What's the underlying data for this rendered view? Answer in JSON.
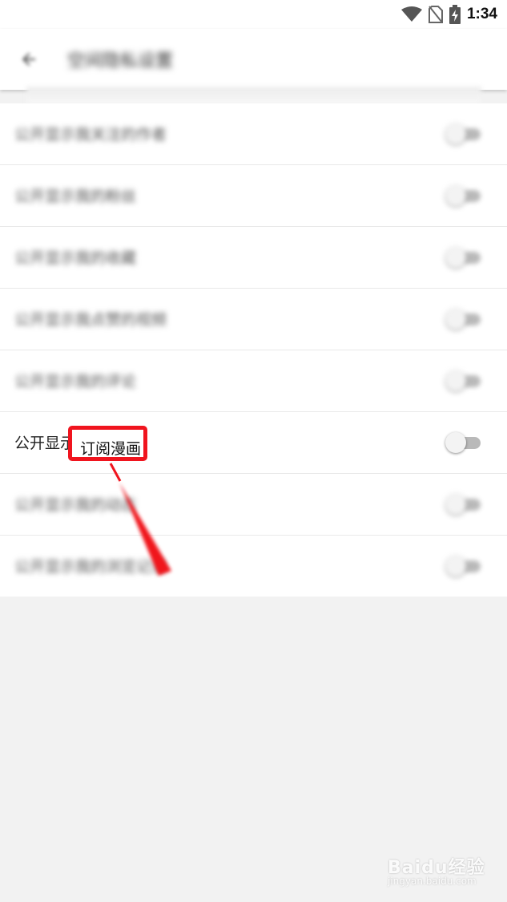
{
  "status_bar": {
    "time": "1:34",
    "icons": [
      "wifi-icon",
      "no-sim-icon",
      "battery-charging-icon"
    ]
  },
  "app_bar": {
    "back_icon": "arrow-left-icon",
    "title": "空间隐私设置"
  },
  "settings": {
    "rows": [
      {
        "label": "公开显示我关注的作者",
        "checked": false
      },
      {
        "label": "公开显示我的粉丝",
        "checked": false
      },
      {
        "label": "公开显示我的收藏",
        "checked": false
      },
      {
        "label": "公开显示我点赞的视频",
        "checked": false
      },
      {
        "label": "公开显示我的评论",
        "checked": false
      },
      {
        "label": "公开显示",
        "checked": false
      },
      {
        "label": "公开显示我的动态",
        "checked": false
      },
      {
        "label": "公开显示我的浏览记录",
        "checked": false
      }
    ]
  },
  "annotation": {
    "highlight_text": "订阅漫画",
    "color": "#f0141e"
  },
  "watermark": {
    "main": "Baidu经验",
    "sub": "jingyan.baidu.com"
  }
}
